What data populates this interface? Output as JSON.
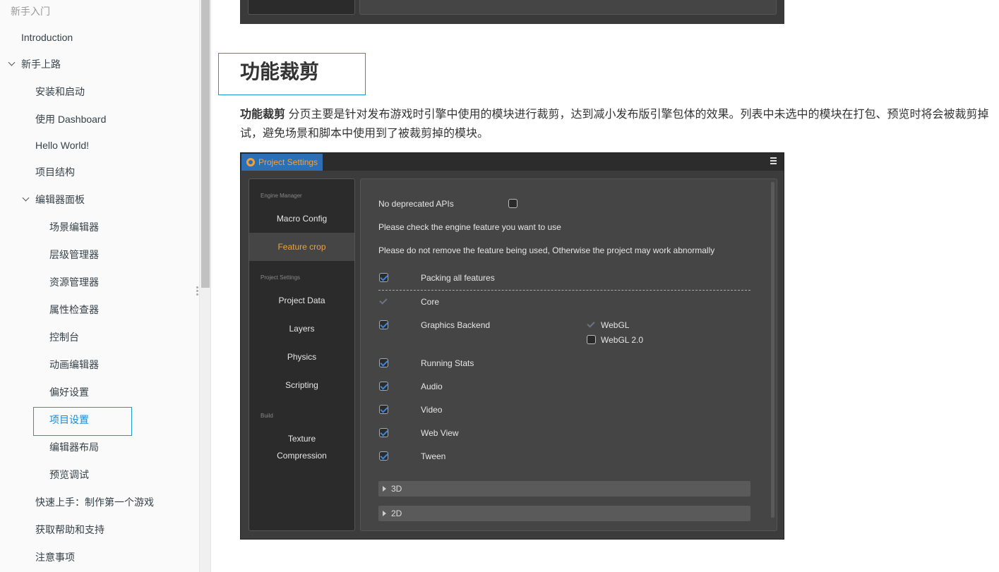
{
  "sidebar": {
    "section_title": "新手入门",
    "items": [
      {
        "label": "Introduction"
      },
      {
        "label": "新手上路"
      },
      {
        "label": "安装和启动"
      },
      {
        "label": "使用 Dashboard"
      },
      {
        "label": "Hello World!"
      },
      {
        "label": "项目结构"
      },
      {
        "label": "编辑器面板"
      },
      {
        "label": "场景编辑器"
      },
      {
        "label": "层级管理器"
      },
      {
        "label": "资源管理器"
      },
      {
        "label": "属性检查器"
      },
      {
        "label": "控制台"
      },
      {
        "label": "动画编辑器"
      },
      {
        "label": "偏好设置"
      },
      {
        "label": "项目设置"
      },
      {
        "label": "编辑器布局"
      },
      {
        "label": "预览调试"
      },
      {
        "label": "快速上手：制作第一个游戏"
      },
      {
        "label": "获取帮助和支持"
      },
      {
        "label": "注意事项"
      }
    ]
  },
  "main": {
    "heading": "功能裁剪",
    "para_bold": "功能裁剪",
    "para_text": " 分页主要是针对发布游戏时引擎中使用的模块进行裁剪，达到减小发布版引擎包体的效果。列表中未选中的模块在打包、预览时将会被裁剪掉试，避免场景和脚本中使用到了被裁剪掉的模块。"
  },
  "project_settings": {
    "tab_title": "Project Settings",
    "left": {
      "group_engine": "Engine Manager",
      "macro_config": "Macro Config",
      "feature_crop": "Feature crop",
      "group_project": "Project Settings",
      "project_data": "Project Data",
      "layers": "Layers",
      "physics": "Physics",
      "scripting": "Scripting",
      "group_build": "Build",
      "texture_1": "Texture",
      "texture_2": "Compression"
    },
    "right": {
      "no_deprecated": "No deprecated APIs",
      "hint1": "Please check the engine feature you want to use",
      "hint2": "Please do not remove the feature being used, Otherwise the project may work abnormally",
      "packing_all": "Packing all features",
      "core": "Core",
      "graphics_backend": "Graphics Backend",
      "webgl": "WebGL",
      "webgl2": "WebGL 2.0",
      "running_stats": "Running Stats",
      "audio": "Audio",
      "video": "Video",
      "web_view": "Web View",
      "tween": "Tween",
      "fold_3d": "3D",
      "fold_2d": "2D"
    }
  }
}
